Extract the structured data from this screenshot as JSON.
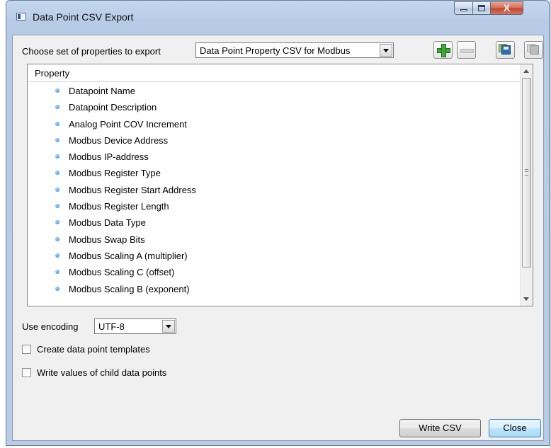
{
  "window": {
    "title": "Data Point CSV Export",
    "close_glyph": "X"
  },
  "toolbar": {
    "choose_label": "Choose set of properties to export",
    "property_set": "Data Point Property CSV for Modbus",
    "icons": [
      "add-icon",
      "remove-icon",
      "save-icon",
      "save-as-icon"
    ]
  },
  "list": {
    "header": "Property",
    "items": [
      "Datapoint Name",
      "Datapoint Description",
      "Analog Point COV Increment",
      "Modbus Device Address",
      "Modbus IP-address",
      "Modbus Register Type",
      "Modbus Register Start Address",
      "Modbus Register Length",
      "Modbus Data Type",
      "Modbus Swap Bits",
      "Modbus Scaling A (multiplier)",
      "Modbus Scaling C (offset)",
      "Modbus Scaling B (exponent)"
    ]
  },
  "options": {
    "encoding_label": "Use encoding",
    "encoding_value": "UTF-8",
    "create_templates_label": "Create data point templates",
    "create_templates_checked": false,
    "write_child_label": "Write values of child data points",
    "write_child_checked": false
  },
  "buttons": {
    "write_csv": "Write CSV",
    "close": "Close"
  },
  "colors": {
    "accent": "#3c7fb1",
    "add_green": "#3fa93a",
    "bullet_blue": "#2b86d6"
  }
}
